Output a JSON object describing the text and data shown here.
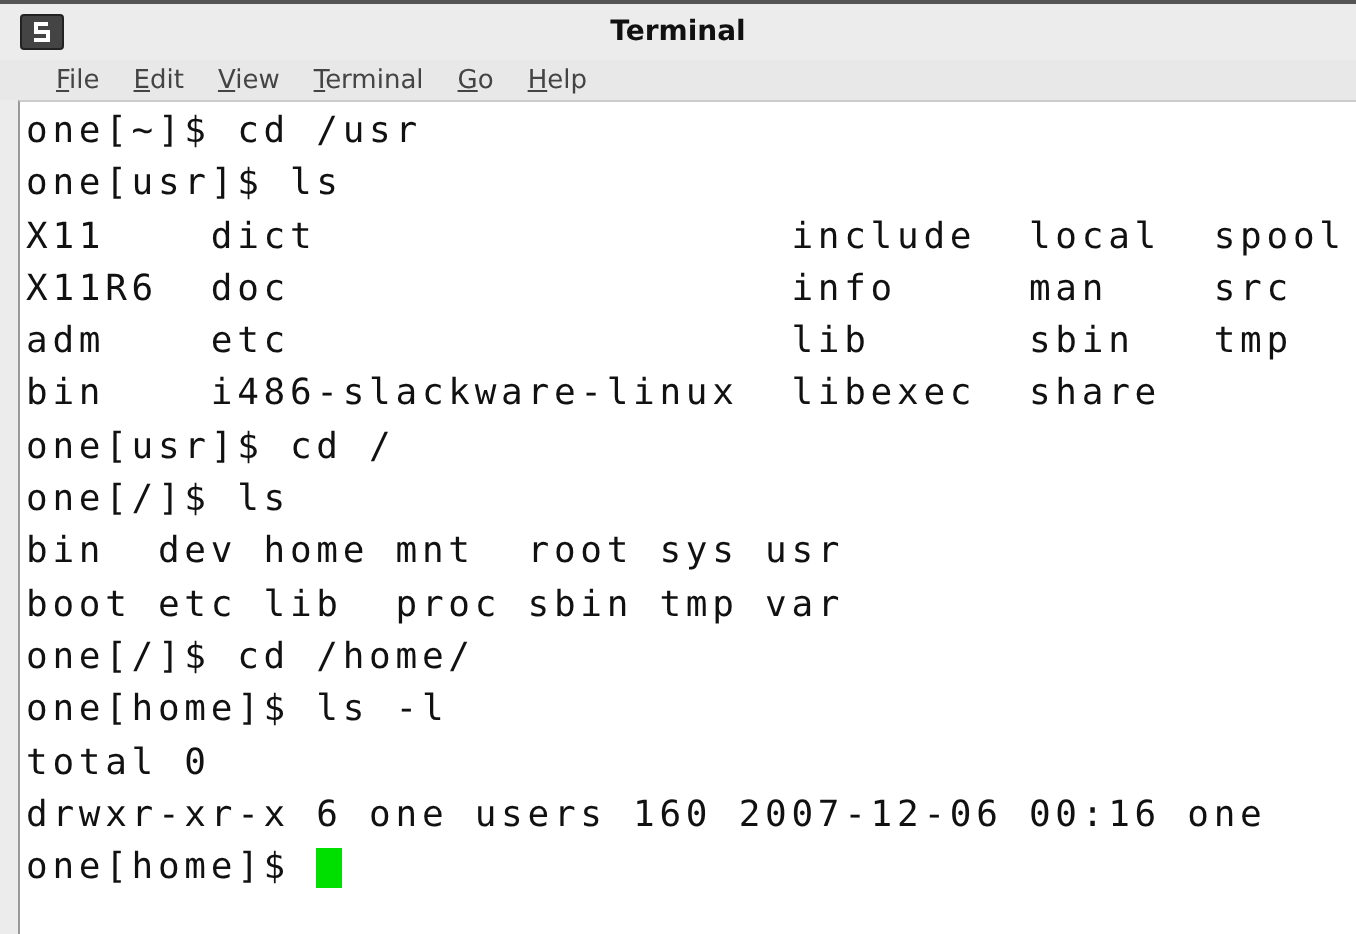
{
  "window": {
    "title": "Terminal"
  },
  "menu": [
    "File",
    "Edit",
    "View",
    "Terminal",
    "Go",
    "Help"
  ],
  "terminal": {
    "lines": [
      "one[~]$ cd /usr",
      "one[usr]$ ls",
      "X11    dict                  include  local  spool",
      "X11R6  doc                   info     man    src",
      "adm    etc                   lib      sbin   tmp",
      "bin    i486-slackware-linux  libexec  share",
      "one[usr]$ cd /",
      "one[/]$ ls",
      "bin  dev home mnt  root sys usr",
      "boot etc lib  proc sbin tmp var",
      "one[/]$ cd /home/",
      "one[home]$ ls -l",
      "total 0",
      "drwxr-xr-x 6 one users 160 2007-12-06 00:16 one",
      "one[home]$ "
    ],
    "cursor": true
  }
}
